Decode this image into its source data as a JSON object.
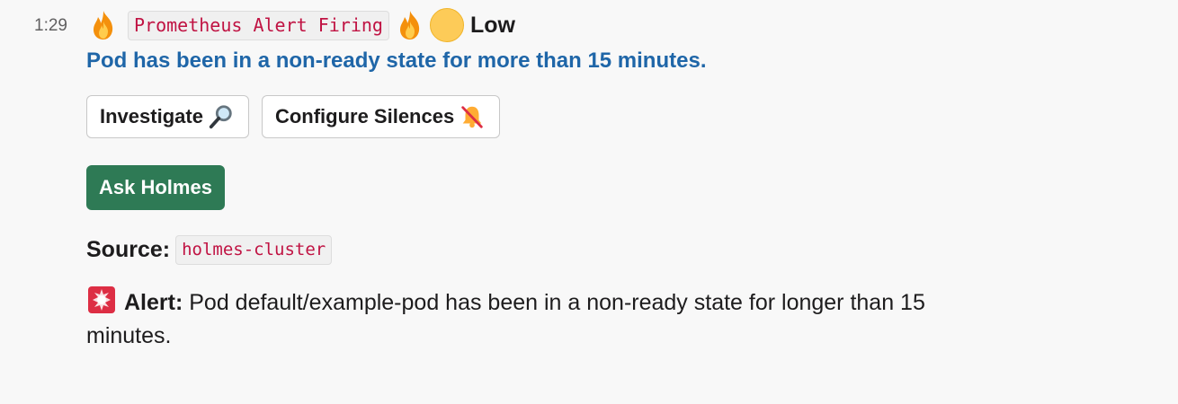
{
  "message": {
    "timestamp": "1:29",
    "title_chip": "Prometheus Alert Firing",
    "severity": "Low",
    "subtitle": "Pod has been in a non-ready state for more than 15 minutes.",
    "buttons": [
      {
        "label": "Investigate",
        "icon": "magnifier-icon"
      },
      {
        "label": "Configure Silences",
        "icon": "bell-slash-icon"
      }
    ],
    "primary_button": {
      "label": "Ask Holmes",
      "color": "#2e7a55"
    },
    "source": {
      "label": "Source:",
      "value": "holmes-cluster"
    },
    "alert": {
      "icon": "siren-icon",
      "label": "Alert:",
      "text": "Pod default/example-pod has been in a non-ready state for longer than 15 minutes."
    }
  },
  "colors": {
    "subtitle": "#1f66a8",
    "code_text": "#c01343",
    "background": "#f8f8f8"
  }
}
